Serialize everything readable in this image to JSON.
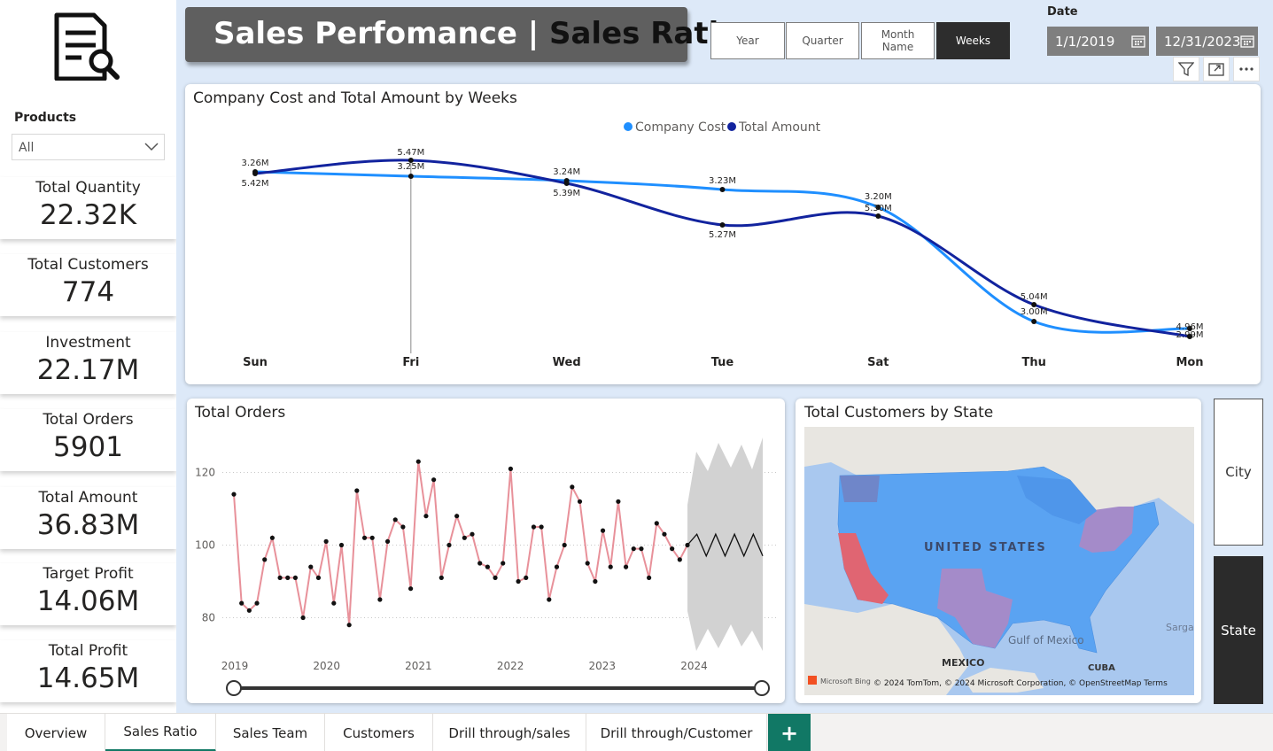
{
  "header": {
    "title_part1": "Sales Perfomance | ",
    "title_part2": "Sales Ratio"
  },
  "period_buttons": [
    {
      "label": "Year"
    },
    {
      "label": "Quarter"
    },
    {
      "label": "Month Name"
    },
    {
      "label": "Weeks"
    }
  ],
  "date": {
    "label": "Date",
    "start": "1/1/2019",
    "end": "12/31/2023"
  },
  "products": {
    "label": "Products",
    "selected": "All"
  },
  "kpis": [
    {
      "label": "Total Quantity",
      "value": "22.32K"
    },
    {
      "label": "Total Customers",
      "value": "774"
    },
    {
      "label": "Investment",
      "value": "22.17M"
    },
    {
      "label": "Total Orders",
      "value": "5901"
    },
    {
      "label": "Total Amount",
      "value": "36.83M"
    },
    {
      "label": "Target Profit",
      "value": "14.06M"
    },
    {
      "label": "Total Profit",
      "value": "14.65M"
    }
  ],
  "chart_data": [
    {
      "type": "line",
      "title": "Company Cost and Total Amount by Weeks",
      "categories": [
        "Sun",
        "Fri",
        "Wed",
        "Tue",
        "Sat",
        "Thu",
        "Mon"
      ],
      "series": [
        {
          "name": "Company Cost",
          "color": "#1f8fff",
          "values": [
            3.26,
            3.25,
            3.24,
            3.23,
            3.2,
            3.0,
            2.99
          ],
          "labels": [
            "3.26M",
            "3.25M",
            "3.24M",
            "3.23M",
            "3.20M",
            "3.00M",
            "2.99M"
          ]
        },
        {
          "name": "Total Amount",
          "color": "#12239e",
          "values": [
            5.42,
            5.47,
            5.39,
            5.27,
            5.3,
            5.04,
            4.96
          ],
          "labels": [
            "5.42M",
            "5.47M",
            "5.39M",
            "5.27M",
            "5.30M",
            "5.04M",
            "4.96M"
          ]
        }
      ],
      "legend": "top-center"
    },
    {
      "type": "line",
      "title": "Total Orders",
      "x_ticks": [
        "2019",
        "2020",
        "2021",
        "2022",
        "2023",
        "2024"
      ],
      "y_ticks": [
        "80",
        "100",
        "120"
      ],
      "ylim": [
        75,
        125
      ],
      "series": [
        {
          "name": "Total Orders",
          "color": "#e8919a",
          "values": [
            114,
            84,
            82,
            84,
            96,
            102,
            91,
            91,
            91,
            80,
            94,
            91,
            101,
            84,
            100,
            78,
            115,
            102,
            102,
            85,
            101,
            107,
            105,
            88,
            123,
            108,
            118,
            91,
            100,
            108,
            102,
            103,
            95,
            94,
            91,
            95,
            121,
            90,
            91,
            105,
            105,
            85,
            94,
            100,
            116,
            112,
            95,
            90,
            104,
            94,
            112,
            94,
            99,
            99,
            91,
            106,
            103,
            99,
            96,
            100
          ]
        },
        {
          "name": "Forecast",
          "color": "#111111",
          "values": [
            100,
            103,
            97,
            103,
            97,
            103,
            97,
            103,
            97
          ]
        }
      ],
      "grid": true
    }
  ],
  "map": {
    "title": "Total Customers by State",
    "labels": {
      "country": "UNITED STATES",
      "mexico": "MEXICO",
      "gulf": "Gulf of Mexico",
      "cuba": "CUBA",
      "sarga": "Sarga"
    },
    "attribution": "© 2024 TomTom, © 2024 Microsoft Corporation, © OpenStreetMap  Terms",
    "bing": "Microsoft Bing",
    "colors": {
      "base": "#5aa3f2",
      "dark": "#2f6fd4",
      "highlight_red": "#e06572",
      "highlight_purple": "#a48bc9",
      "land": "#e8e6e1",
      "water": "#a9c8ef"
    }
  },
  "geo_buttons": [
    {
      "label": "City"
    },
    {
      "label": "State"
    }
  ],
  "tabs": [
    {
      "label": "Overview"
    },
    {
      "label": "Sales Ratio"
    },
    {
      "label": "Sales Team"
    },
    {
      "label": "Customers"
    },
    {
      "label": "Drill through/sales"
    },
    {
      "label": "Drill through/Customer"
    }
  ],
  "tab_add": "+"
}
